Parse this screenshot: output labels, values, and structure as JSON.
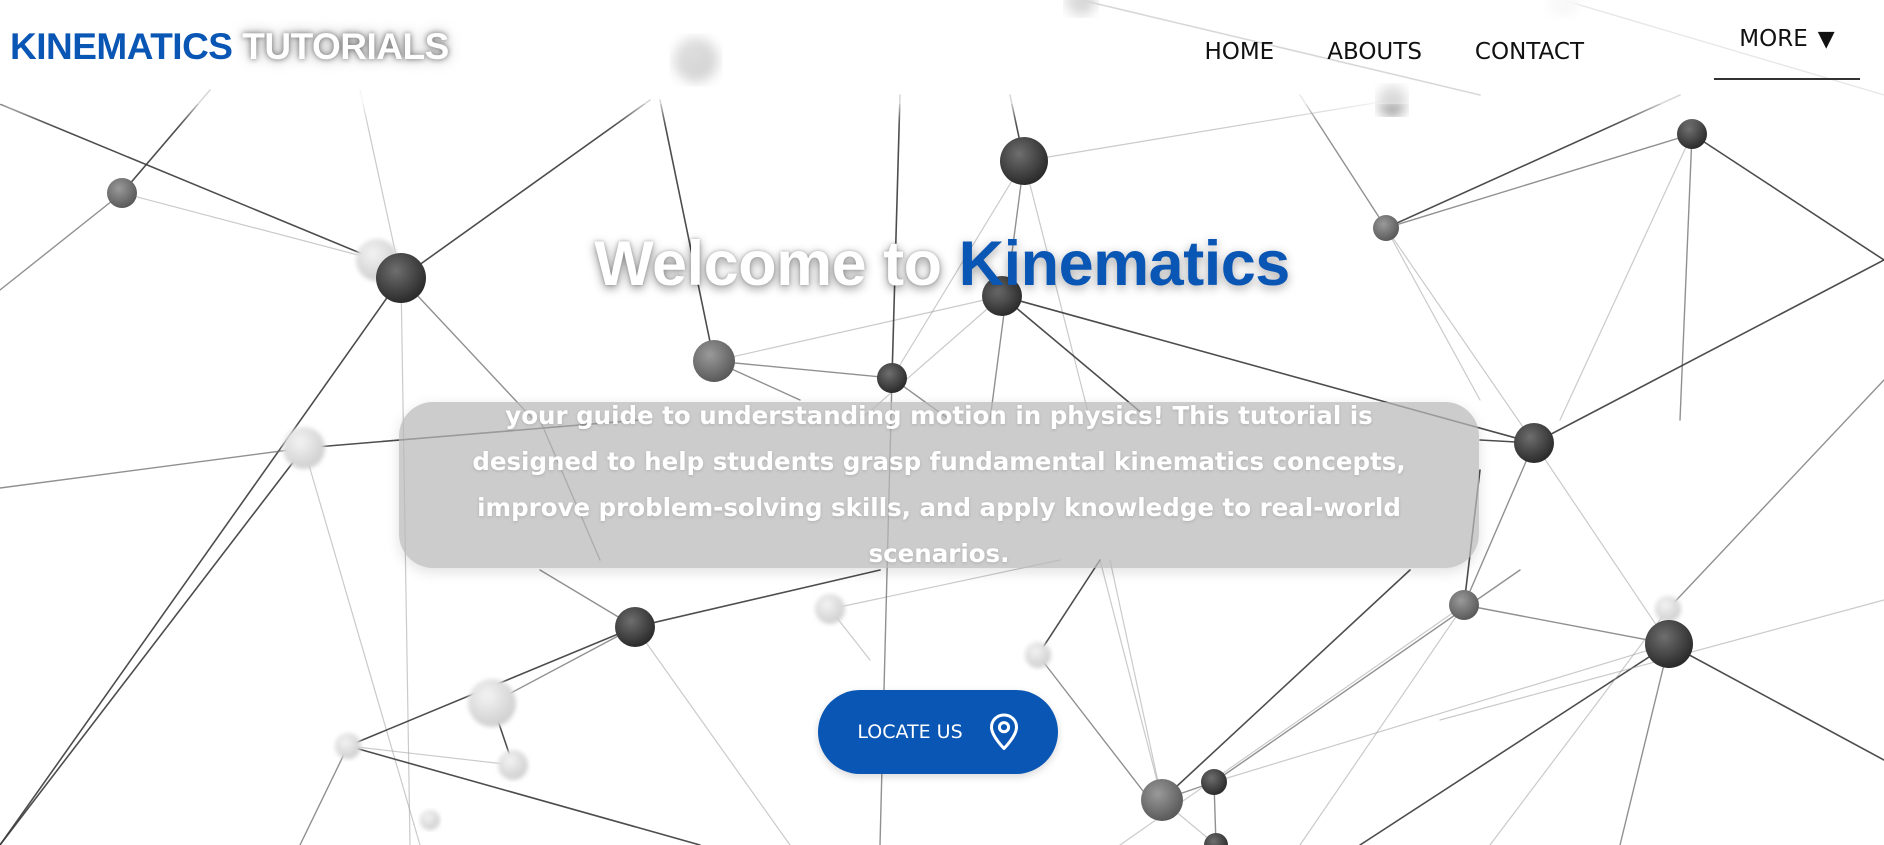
{
  "colors": {
    "brand_blue": "#0a56b5",
    "nav_text": "#111111",
    "hero_box_bg": "#b9b9b9",
    "background": "#ffffff"
  },
  "navbar": {
    "brand_primary": "KINEMATICS",
    "brand_secondary": "TUTORIALS",
    "links": [
      {
        "label": "HOME"
      },
      {
        "label": "ABOUTS"
      },
      {
        "label": "CONTACT"
      }
    ],
    "more_label": "MORE",
    "more_caret": "▼"
  },
  "hero": {
    "title_lead": "Welcome to",
    "title_highlight": "Kinematics",
    "description": "your guide to understanding motion in physics! This tutorial is designed to help students grasp fundamental kinematics concepts, improve problem-solving skills, and apply knowledge to real-world scenarios.",
    "cta_label": "LOCATE US",
    "cta_icon": "map-pin-icon"
  },
  "background_graphic": "molecular-network-icon"
}
